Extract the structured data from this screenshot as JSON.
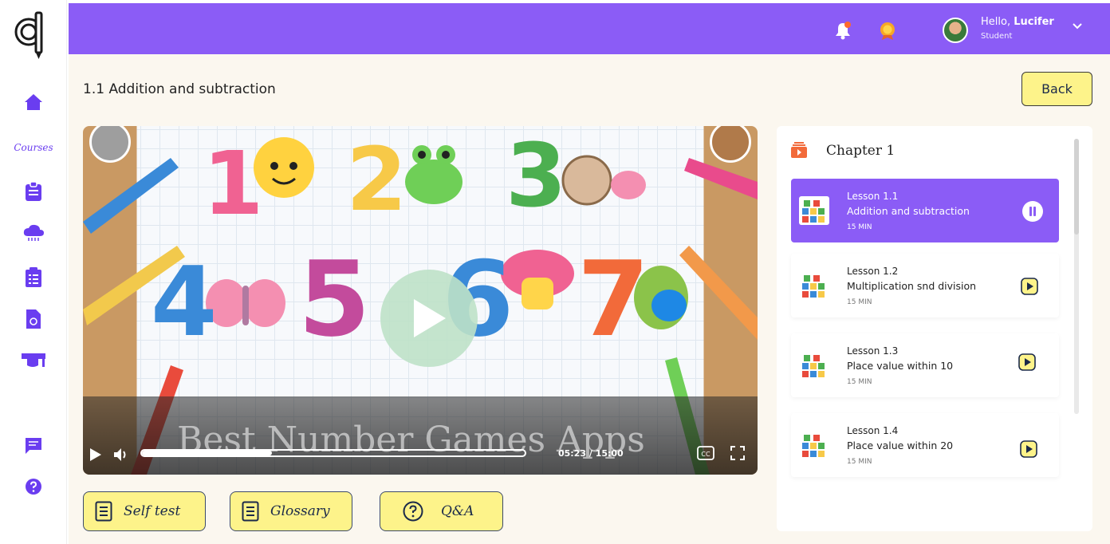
{
  "user": {
    "greeting": "Hello,",
    "name": "Lucifer",
    "role": "Student"
  },
  "sidebar": {
    "courses_label": "Courses"
  },
  "page": {
    "title": "1.1 Addition and subtraction",
    "back_label": "Back"
  },
  "video": {
    "overlay_title": "Best Number Games Apps",
    "time": "05:23 / 15:00",
    "progress": 0.34
  },
  "actions": [
    {
      "label": "Self test",
      "icon": "document-icon"
    },
    {
      "label": "Glossary",
      "icon": "document-icon"
    },
    {
      "label": "Q&A",
      "icon": "question-icon"
    }
  ],
  "chapter": {
    "title": "Chapter 1",
    "lessons": [
      {
        "number": "Lesson 1.1",
        "name": "Addition and subtraction",
        "duration": "15 MIN",
        "state": "playing"
      },
      {
        "number": "Lesson 1.2",
        "name": "Multiplication snd division",
        "duration": "15 MIN",
        "state": "idle"
      },
      {
        "number": "Lesson 1.3",
        "name": "Place value within 10",
        "duration": "15 MIN",
        "state": "idle"
      },
      {
        "number": "Lesson 1.4",
        "name": "Place value within 20",
        "duration": "15 MIN",
        "state": "idle"
      }
    ]
  },
  "colors": {
    "brand": "#8b5cf6",
    "button_yellow": "#fdf38a",
    "nav_purple": "#6a3df0"
  }
}
